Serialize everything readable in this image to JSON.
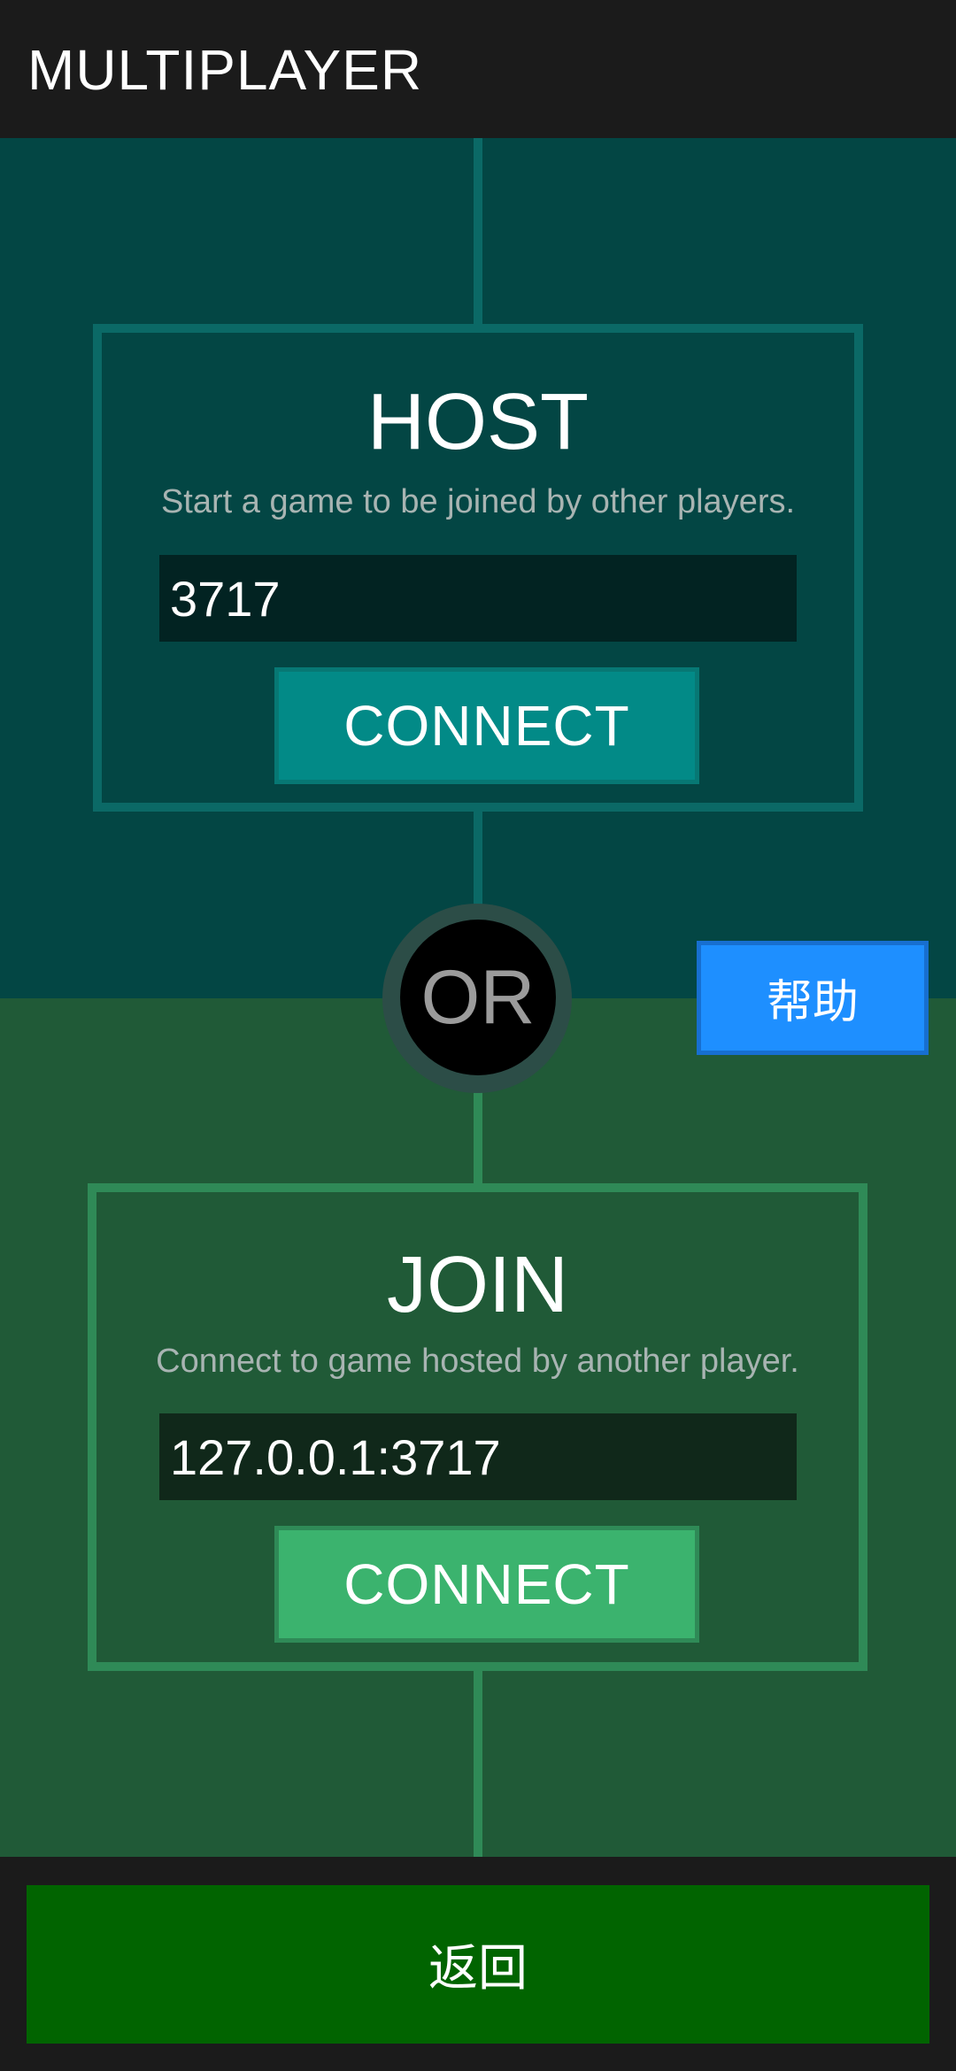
{
  "header": {
    "title": "MULTIPLAYER"
  },
  "host": {
    "heading": "HOST",
    "subtitle": "Start a game to be joined by other players.",
    "port_value": "3717",
    "connect_label": "CONNECT"
  },
  "divider": {
    "label": "OR"
  },
  "help_button": {
    "label": "帮助"
  },
  "join": {
    "heading": "JOIN",
    "subtitle": "Connect to game hosted by another player.",
    "address_value": "127.0.0.1:3717",
    "connect_label": "CONNECT"
  },
  "footer": {
    "back_label": "返回"
  },
  "colors": {
    "host_background": "#034644",
    "join_background": "#205a37",
    "host_button": "#028a87",
    "join_button": "#3bb36e",
    "help_button": "#1e8fff",
    "back_button": "#016400"
  }
}
